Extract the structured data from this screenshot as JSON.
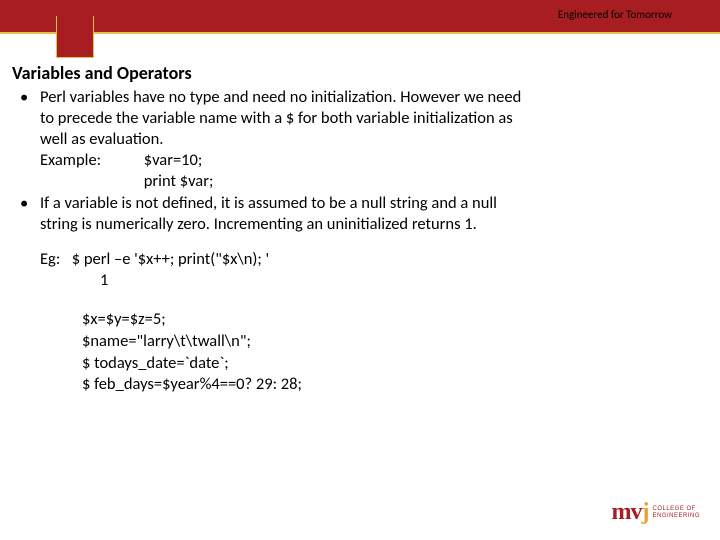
{
  "header": {
    "tagline": "Engineered for Tomorrow"
  },
  "slide": {
    "title": "Variables and Operators",
    "bullet1_line1": "Perl variables have no type and need no initialization. However we need",
    "bullet1_line2": "to precede the variable name with a $ for both variable initialization as",
    "bullet1_line3": "well as evaluation.",
    "example_label": "Example:",
    "example_code1": "$var=10;",
    "example_code2": "print $var;",
    "bullet2_line1": "If  a variable is not defined, it is assumed to be a null string and a null",
    "bullet2_line2": "string is numerically zero. Incrementing an uninitialized returns 1.",
    "eg_label": "Eg:",
    "eg_line1": "$ perl –e '$x++; print(\"$x\\n); '",
    "eg_line2": "1",
    "code1": "$x=$y=$z=5;",
    "code2": "$name=\"larry\\t\\twall\\n\";",
    "code3": "$ todays_date=`date`;",
    "code4": "$ feb_days=$year%4==0? 29: 28;"
  },
  "footer": {
    "logo_main": "m",
    "logo_v": "v",
    "logo_j": "j",
    "logo_sub1": "COLLEGE OF",
    "logo_sub2": "ENGINEERING"
  }
}
